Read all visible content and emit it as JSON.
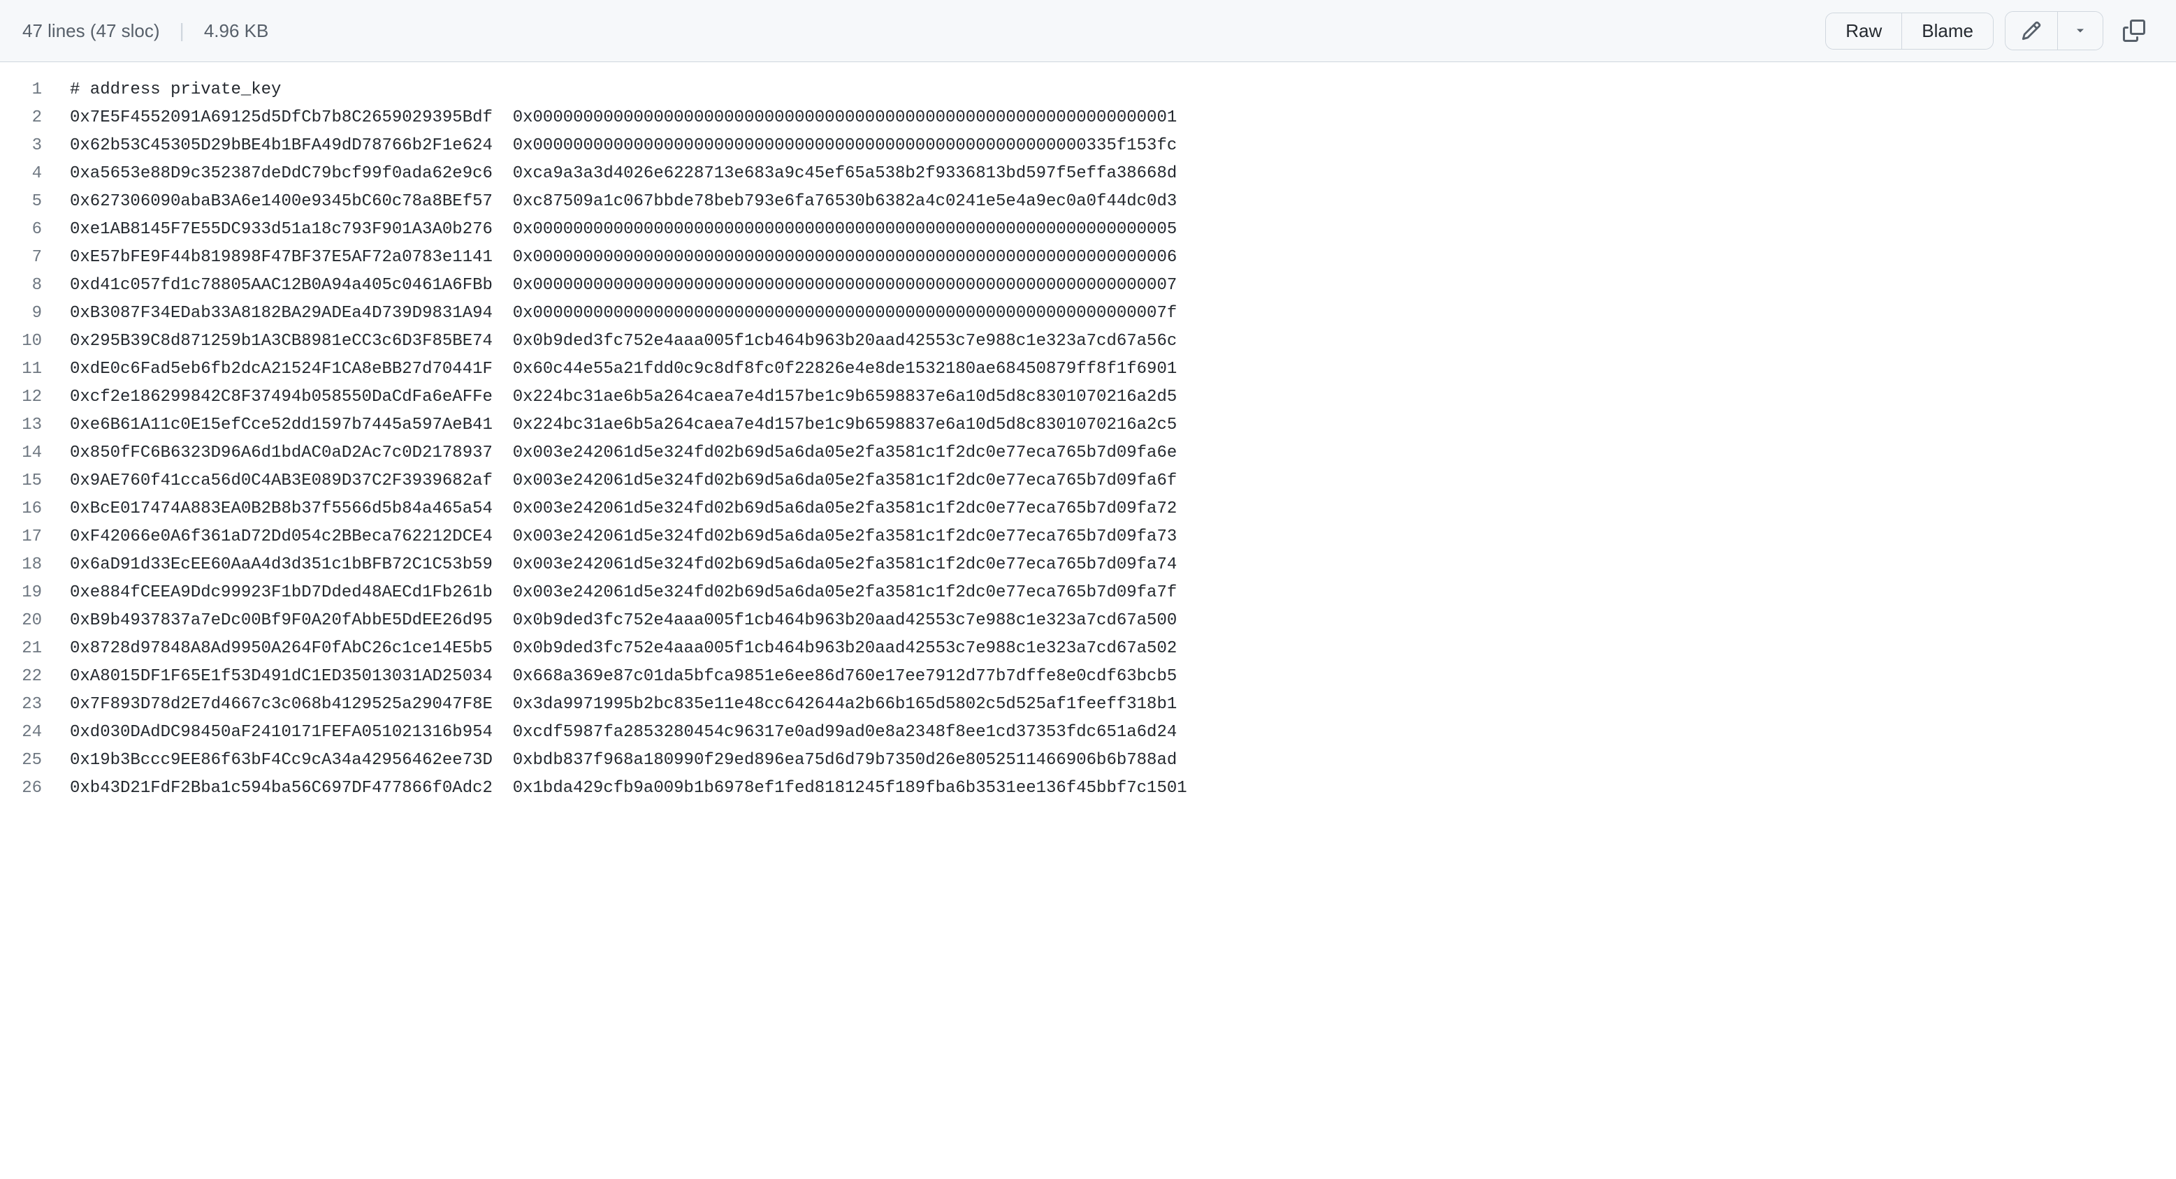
{
  "header": {
    "lines_info": "47 lines (47 sloc)",
    "size_info": "4.96 KB",
    "raw_label": "Raw",
    "blame_label": "Blame"
  },
  "code": {
    "header_comment": "# address private_key",
    "rows": [
      {
        "address": "0x7E5F4552091A69125d5DfCb7b8C2659029395Bdf",
        "key": "0x0000000000000000000000000000000000000000000000000000000000000001"
      },
      {
        "address": "0x62b53C45305D29bBE4b1BFA49dD78766b2F1e624",
        "key": "0x0000000000000000000000000000000000000000000000000000000335f153fc"
      },
      {
        "address": "0xa5653e88D9c352387deDdC79bcf99f0ada62e9c6",
        "key": "0xca9a3a3d4026e6228713e683a9c45ef65a538b2f9336813bd597f5effa38668d"
      },
      {
        "address": "0x627306090abaB3A6e1400e9345bC60c78a8BEf57",
        "key": "0xc87509a1c067bbde78beb793e6fa76530b6382a4c0241e5e4a9ec0a0f44dc0d3"
      },
      {
        "address": "0xe1AB8145F7E55DC933d51a18c793F901A3A0b276",
        "key": "0x0000000000000000000000000000000000000000000000000000000000000005"
      },
      {
        "address": "0xE57bFE9F44b819898F47BF37E5AF72a0783e1141",
        "key": "0x0000000000000000000000000000000000000000000000000000000000000006"
      },
      {
        "address": "0xd41c057fd1c78805AAC12B0A94a405c0461A6FBb",
        "key": "0x0000000000000000000000000000000000000000000000000000000000000007"
      },
      {
        "address": "0xB3087F34EDab33A8182BA29ADEa4D739D9831A94",
        "key": "0x000000000000000000000000000000000000000000000000000000000000007f"
      },
      {
        "address": "0x295B39C8d871259b1A3CB8981eCC3c6D3F85BE74",
        "key": "0x0b9ded3fc752e4aaa005f1cb464b963b20aad42553c7e988c1e323a7cd67a56c"
      },
      {
        "address": "0xdE0c6Fad5eb6fb2dcA21524F1CA8eBB27d70441F",
        "key": "0x60c44e55a21fdd0c9c8df8fc0f22826e4e8de1532180ae68450879ff8f1f6901"
      },
      {
        "address": "0xcf2e186299842C8F37494b058550DaCdFa6eAFFe",
        "key": "0x224bc31ae6b5a264caea7e4d157be1c9b6598837e6a10d5d8c8301070216a2d5"
      },
      {
        "address": "0xe6B61A11c0E15efCce52dd1597b7445a597AeB41",
        "key": "0x224bc31ae6b5a264caea7e4d157be1c9b6598837e6a10d5d8c8301070216a2c5"
      },
      {
        "address": "0x850fFC6B6323D96A6d1bdAC0aD2Ac7c0D2178937",
        "key": "0x003e242061d5e324fd02b69d5a6da05e2fa3581c1f2dc0e77eca765b7d09fa6e"
      },
      {
        "address": "0x9AE760f41cca56d0C4AB3E089D37C2F3939682af",
        "key": "0x003e242061d5e324fd02b69d5a6da05e2fa3581c1f2dc0e77eca765b7d09fa6f"
      },
      {
        "address": "0xBcE017474A883EA0B2B8b37f5566d5b84a465a54",
        "key": "0x003e242061d5e324fd02b69d5a6da05e2fa3581c1f2dc0e77eca765b7d09fa72"
      },
      {
        "address": "0xF42066e0A6f361aD72Dd054c2BBeca762212DCE4",
        "key": "0x003e242061d5e324fd02b69d5a6da05e2fa3581c1f2dc0e77eca765b7d09fa73"
      },
      {
        "address": "0x6aD91d33EcEE60AaA4d3d351c1bBFB72C1C53b59",
        "key": "0x003e242061d5e324fd02b69d5a6da05e2fa3581c1f2dc0e77eca765b7d09fa74"
      },
      {
        "address": "0xe884fCEEA9Ddc99923F1bD7Dded48AECd1Fb261b",
        "key": "0x003e242061d5e324fd02b69d5a6da05e2fa3581c1f2dc0e77eca765b7d09fa7f"
      },
      {
        "address": "0xB9b4937837a7eDc00Bf9F0A20fAbbE5DdEE26d95",
        "key": "0x0b9ded3fc752e4aaa005f1cb464b963b20aad42553c7e988c1e323a7cd67a500"
      },
      {
        "address": "0x8728d97848A8Ad9950A264F0fAbC26c1ce14E5b5",
        "key": "0x0b9ded3fc752e4aaa005f1cb464b963b20aad42553c7e988c1e323a7cd67a502"
      },
      {
        "address": "0xA8015DF1F65E1f53D491dC1ED35013031AD25034",
        "key": "0x668a369e87c01da5bfca9851e6ee86d760e17ee7912d77b7dffe8e0cdf63bcb5"
      },
      {
        "address": "0x7F893D78d2E7d4667c3c068b4129525a29047F8E",
        "key": "0x3da9971995b2bc835e11e48cc642644a2b66b165d5802c5d525af1feeff318b1"
      },
      {
        "address": "0xd030DAdDC98450aF2410171FEFA051021316b954",
        "key": "0xcdf5987fa2853280454c96317e0ad99ad0e8a2348f8ee1cd37353fdc651a6d24"
      },
      {
        "address": "0x19b3Bccc9EE86f63bF4Cc9cA34a42956462ee73D",
        "key": "0xbdb837f968a180990f29ed896ea75d6d79b7350d26e8052511466906b6b788ad"
      },
      {
        "address": "0xb43D21FdF2Bba1c594ba56C697DF477866f0Adc2",
        "key": "0x1bda429cfb9a009b1b6978ef1fed8181245f189fba6b3531ee136f45bbf7c1501"
      }
    ]
  }
}
